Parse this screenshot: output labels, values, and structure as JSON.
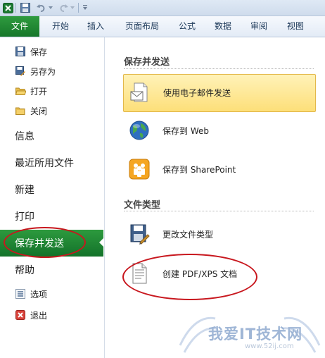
{
  "ribbon": {
    "tabs": [
      "文件",
      "开始",
      "插入",
      "页面布局",
      "公式",
      "数据",
      "审阅",
      "视图"
    ]
  },
  "backstage": {
    "small_top": [
      {
        "label": "保存",
        "icon": "save-icon"
      },
      {
        "label": "另存为",
        "icon": "save-as-icon"
      },
      {
        "label": "打开",
        "icon": "open-folder-icon"
      },
      {
        "label": "关闭",
        "icon": "close-folder-icon"
      }
    ],
    "big": [
      "信息",
      "最近所用文件",
      "新建",
      "打印",
      "保存并发送",
      "帮助"
    ],
    "small_bottom": [
      {
        "label": "选项",
        "icon": "options-icon"
      },
      {
        "label": "退出",
        "icon": "exit-icon"
      }
    ],
    "selected": "保存并发送"
  },
  "share": {
    "section1_title": "保存并发送",
    "options1": [
      "使用电子邮件发送",
      "保存到 Web",
      "保存到 SharePoint"
    ],
    "section2_title": "文件类型",
    "options2": [
      "更改文件类型",
      "创建 PDF/XPS 文档"
    ]
  },
  "watermark": {
    "text": "我爱IT技术网",
    "url": "www.52ij.com"
  },
  "colors": {
    "accent_green": "#1f8a34",
    "highlight_yellow": "#fde27f",
    "annotation_red": "#c8171e"
  }
}
